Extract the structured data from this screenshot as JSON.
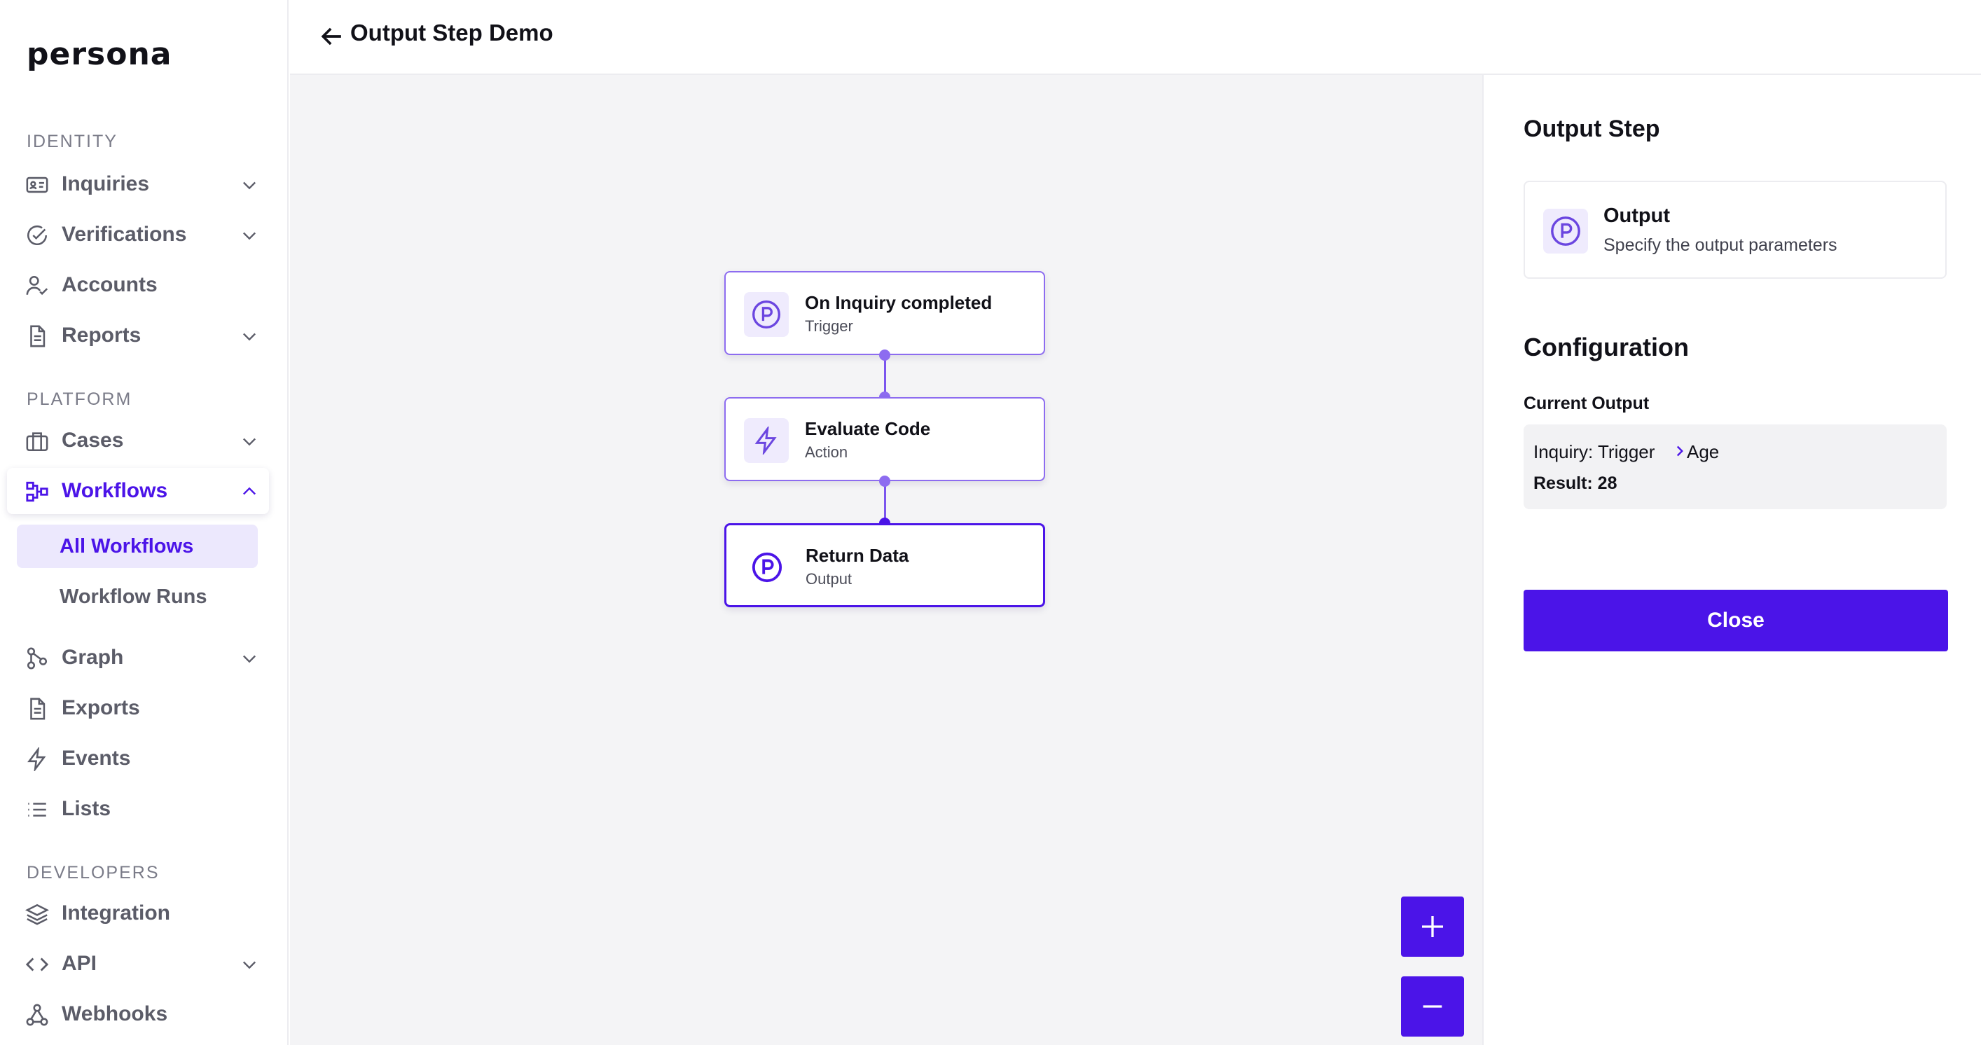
{
  "brand": {
    "logo_text": "persona",
    "accent": "#4b14e8"
  },
  "sidebar": {
    "sections": {
      "identity": "IDENTITY",
      "platform": "PLATFORM",
      "developers": "DEVELOPERS"
    },
    "items": {
      "inquiries": "Inquiries",
      "verifications": "Verifications",
      "accounts": "Accounts",
      "reports": "Reports",
      "cases": "Cases",
      "workflows": "Workflows",
      "all_workflows": "All Workflows",
      "workflow_runs": "Workflow Runs",
      "graph": "Graph",
      "exports": "Exports",
      "events": "Events",
      "lists": "Lists",
      "integration": "Integration",
      "api": "API",
      "webhooks": "Webhooks"
    }
  },
  "header": {
    "title": "Output Step Demo"
  },
  "canvas": {
    "nodes": [
      {
        "title": "On Inquiry completed",
        "subtitle": "Trigger",
        "icon": "persona-p-icon"
      },
      {
        "title": "Evaluate Code",
        "subtitle": "Action",
        "icon": "lightning-icon"
      },
      {
        "title": "Return Data",
        "subtitle": "Output",
        "icon": "persona-p-icon"
      }
    ],
    "zoom_in_icon": "plus-icon",
    "zoom_out_icon": "minus-icon"
  },
  "panel": {
    "title": "Output Step",
    "card": {
      "title": "Output",
      "subtitle": "Specify the output parameters"
    },
    "config_title": "Configuration",
    "current_output_label": "Current Output",
    "output": {
      "source": "Inquiry: Trigger",
      "field": "Age",
      "result": "Result: 28"
    },
    "close_label": "Close"
  }
}
